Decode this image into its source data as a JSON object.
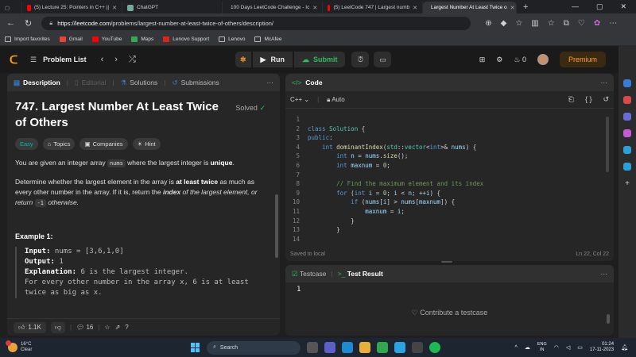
{
  "browser": {
    "tabs": [
      {
        "title": "(5) Lecture 25: Pointers in C++ ||",
        "color": "#ff0000",
        "active": false
      },
      {
        "title": "ChatGPT",
        "color": "#74aa9c",
        "active": false
      },
      {
        "title": "100 Days LeetCode Challenge - Ic",
        "color": "#888888",
        "active": false
      },
      {
        "title": "(5) LeetCode 747 | Largest numb",
        "color": "#ff0000",
        "active": false
      },
      {
        "title": "Largest Number At Least Twice o",
        "color": "#ffa116",
        "active": true
      }
    ],
    "new_tab": "+",
    "url_host": "https://leetcode.com",
    "url_path": "/problems/largest-number-at-least-twice-of-others/description/"
  },
  "bookmarks": [
    {
      "label": "Import favorites",
      "color": "#bbbbbb"
    },
    {
      "label": "Gmail",
      "color": "#ea4335"
    },
    {
      "label": "YouTube",
      "color": "#ff0000"
    },
    {
      "label": "Maps",
      "color": "#34a853"
    },
    {
      "label": "Lenovo Support",
      "color": "#e2231a"
    },
    {
      "label": "Lenovo",
      "color": "#bbbbbb"
    },
    {
      "label": "McAfee",
      "color": "#bbbbbb"
    }
  ],
  "nav": {
    "problem_list": "Problem List",
    "run": "Run",
    "submit": "Submit",
    "streak": "0",
    "premium": "Premium"
  },
  "left": {
    "tabs": {
      "description": "Description",
      "editorial": "Editorial",
      "solutions": "Solutions",
      "submissions": "Submissions"
    },
    "title": "747. Largest Number At Least Twice of Others",
    "solved": "Solved",
    "tags": {
      "difficulty": "Easy",
      "topics": "Topics",
      "companies": "Companies",
      "hint": "Hint"
    },
    "p1_a": "You are given an integer array ",
    "p1_code": "nums",
    "p1_b": " where the largest integer is ",
    "p1_bold": "unique",
    "p1_end": ".",
    "p2_a": "Determine whether the largest element in the array is ",
    "p2_bold": "at least twice",
    "p2_b": " as much as every other number in the array. If it is, return the ",
    "p2_boldi": "index",
    "p2_c": " of the largest element, or return ",
    "p2_code": "-1",
    "p2_d": " otherwise.",
    "example_heading": "Example 1:",
    "ex_input_label": "Input:",
    "ex_input": " nums = [3,6,1,0]",
    "ex_output_label": "Output:",
    "ex_output": " 1",
    "ex_expl_label": "Explanation:",
    "ex_expl": " 6 is the largest integer.",
    "ex_line4": "For every other number in the array x, 6 is at least",
    "ex_line5": "twice as big as x.",
    "likes": "1.1K",
    "comments": "16"
  },
  "code": {
    "header": "Code",
    "language": "C++",
    "mode": "Auto",
    "status_left": "Saved to local",
    "status_right": "Ln 22, Col 22",
    "line_numbers": [
      "1",
      "2",
      "3",
      "4",
      "5",
      "6",
      "7",
      "8",
      "9",
      "10",
      "11",
      "12",
      "13",
      "14"
    ]
  },
  "test": {
    "testcase": "Testcase",
    "result": "Test Result",
    "value": "1",
    "contribute": "Contribute a testcase"
  },
  "taskbar": {
    "temp": "16°C",
    "weather": "Clear",
    "search": "Search",
    "lang1": "ENG",
    "lang2": "IN",
    "time": "01:24",
    "date": "17-11-2023"
  }
}
